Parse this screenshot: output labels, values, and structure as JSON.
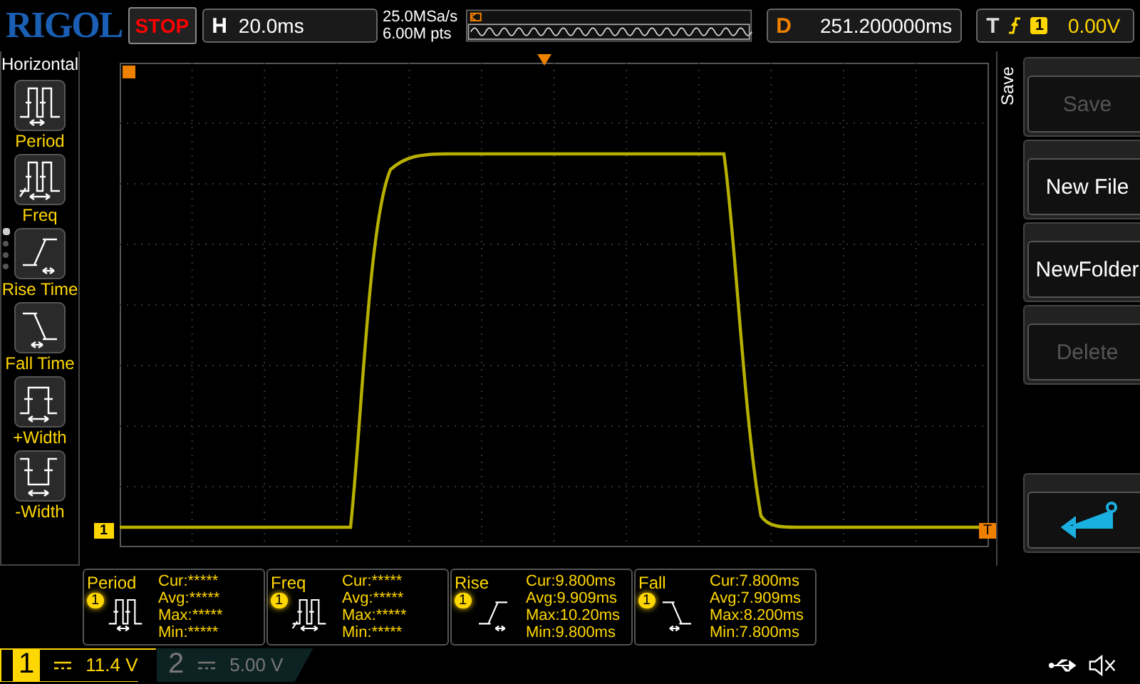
{
  "top_bar": {
    "brand": "RIGOL",
    "run_state": "STOP",
    "horizontal": {
      "label": "H",
      "timebase": "20.0ms"
    },
    "sample_rate": "25.0MSa/s",
    "memory_depth": "6.00M pts",
    "delay": {
      "label": "D",
      "value": "251.200000ms"
    },
    "trigger": {
      "label": "T",
      "source": "1",
      "level": "0.00V"
    }
  },
  "sidebar": {
    "title": "Horizontal",
    "items": [
      {
        "label": "Period",
        "kind": "period"
      },
      {
        "label": "Freq",
        "kind": "freq"
      },
      {
        "label": "Rise Time",
        "kind": "rise"
      },
      {
        "label": "Fall Time",
        "kind": "fall"
      },
      {
        "label": "+Width",
        "kind": "pwidth"
      },
      {
        "label": "-Width",
        "kind": "nwidth"
      }
    ],
    "pages": [
      {
        "selected": true
      },
      {
        "selected": false
      },
      {
        "selected": false
      },
      {
        "selected": false
      }
    ]
  },
  "screen": {
    "channel_marker": "1",
    "trigger_marker": "T"
  },
  "measurements": [
    {
      "name": "Period",
      "channel": "1",
      "kind": "period",
      "cur": "Cur:*****",
      "avg": "Avg:*****",
      "max": "Max:*****",
      "min": "Min:*****"
    },
    {
      "name": "Freq",
      "channel": "1",
      "kind": "freq",
      "cur": "Cur:*****",
      "avg": "Avg:*****",
      "max": "Max:*****",
      "min": "Min:*****"
    },
    {
      "name": "Rise",
      "channel": "1",
      "kind": "rise",
      "cur": "Cur:9.800ms",
      "avg": "Avg:9.909ms",
      "max": "Max:10.20ms",
      "min": "Min:9.800ms"
    },
    {
      "name": "Fall",
      "channel": "1",
      "kind": "fall",
      "cur": "Cur:7.800ms",
      "avg": "Avg:7.909ms",
      "max": "Max:8.200ms",
      "min": "Min:7.800ms"
    }
  ],
  "menu": {
    "title": "Save",
    "buttons": [
      {
        "kind": "text",
        "label": "Save",
        "disabled": true
      },
      {
        "kind": "text",
        "label": "New File",
        "disabled": false
      },
      {
        "kind": "text",
        "label": "NewFolder",
        "disabled": false
      },
      {
        "kind": "text",
        "label": "Delete",
        "disabled": true
      },
      {
        "kind": "back"
      }
    ]
  },
  "channels": [
    {
      "number": "1",
      "scale": "11.4 V",
      "on": true
    },
    {
      "number": "2",
      "scale": "5.00 V",
      "on": false
    }
  ]
}
